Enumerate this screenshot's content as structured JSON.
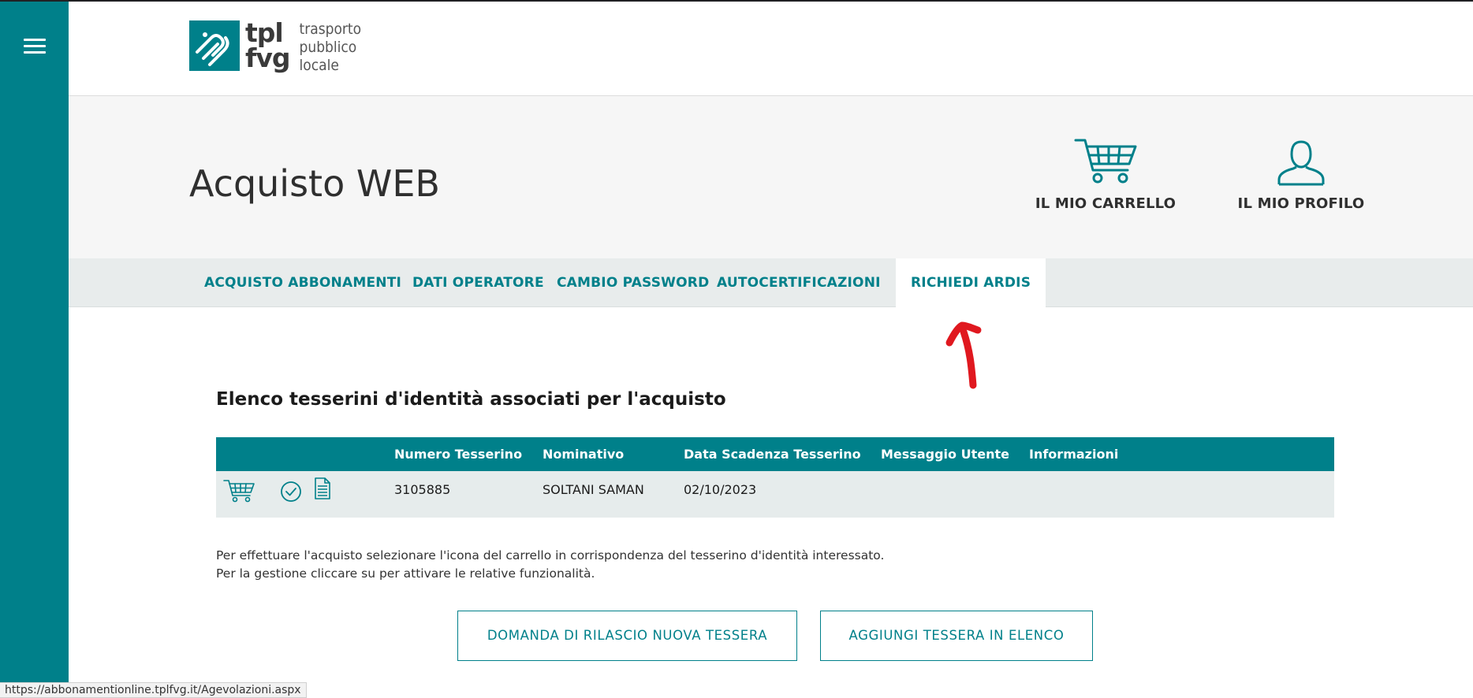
{
  "logo": {
    "brand_line1": "tpl",
    "brand_line2": "fvg",
    "tagline_1": "trasporto",
    "tagline_2": "pubblico",
    "tagline_3": "locale"
  },
  "hero": {
    "title": "Acquisto WEB",
    "cart_label": "IL MIO CARRELLO",
    "profile_label": "IL MIO PROFILO"
  },
  "tabs": [
    {
      "label": "ACQUISTO ABBONAMENTI"
    },
    {
      "label": "DATI OPERATORE"
    },
    {
      "label": "CAMBIO PASSWORD"
    },
    {
      "label": "AUTOCERTIFICAZIONI"
    },
    {
      "label": "RICHIEDI ARDIS",
      "active": true
    }
  ],
  "section": {
    "title": "Elenco tesserini d'identità associati per l'acquisto"
  },
  "table": {
    "headers": [
      "Numero Tesserino",
      "Nominativo",
      "Data Scadenza Tesserino",
      "Messaggio Utente",
      "Informazioni"
    ],
    "rows": [
      {
        "numero": "3105885",
        "nominativo": "SOLTANI SAMAN",
        "scadenza": "02/10/2023",
        "messaggio": "",
        "informazioni": ""
      }
    ]
  },
  "hints": {
    "line1": "Per effettuare l'acquisto selezionare l'icona del carrello in corrispondenza del tesserino d'identità interessato.",
    "line2": "Per la gestione cliccare su per attivare le relative funzionalità."
  },
  "buttons": {
    "new_card": "DOMANDA DI RILASCIO NUOVA TESSERA",
    "add_card": "AGGIUNGI TESSERA IN ELENCO"
  },
  "status_url": "https://abbonamentionline.tplfvg.it/Agevolazioni.aspx",
  "colors": {
    "accent": "#00808a",
    "annotation": "#e0181f"
  },
  "icons": [
    "menu-icon",
    "cart-icon",
    "user-icon",
    "check-circle-icon",
    "document-icon"
  ]
}
